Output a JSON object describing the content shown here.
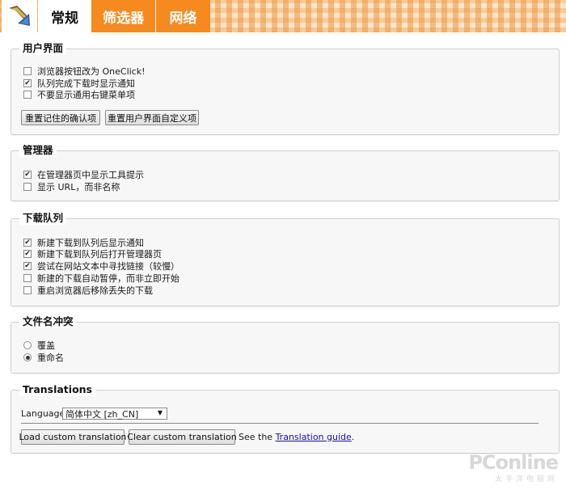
{
  "tabs": [
    {
      "label": "常规",
      "active": true
    },
    {
      "label": "筛选器",
      "active": false
    },
    {
      "label": "网络",
      "active": false
    }
  ],
  "ui_section": {
    "title": "用户界面",
    "options": [
      {
        "label": "浏览器按钮改为 OneClick!",
        "checked": false
      },
      {
        "label": "队列完成下载时显示通知",
        "checked": true
      },
      {
        "label": "不要显示通用右键菜单项",
        "checked": false
      }
    ],
    "reset_confirm_label": "重置记住的确认项",
    "reset_custom_label": "重置用户界面自定义项"
  },
  "manager_section": {
    "title": "管理器",
    "options": [
      {
        "label": "在管理器页中显示工具提示",
        "checked": true
      },
      {
        "label": "显示 URL，而非名称",
        "checked": false
      }
    ]
  },
  "queue_section": {
    "title": "下载队列",
    "options": [
      {
        "label": "新建下载到队列后显示通知",
        "checked": true
      },
      {
        "label": "新建下载到队列后打开管理器页",
        "checked": true
      },
      {
        "label": "尝试在网站文本中寻找链接（较慢）",
        "checked": true
      },
      {
        "label": "新建的下载自动暂停，而非立即开始",
        "checked": false
      },
      {
        "label": "重启浏览器后移除丢失的下载",
        "checked": false
      }
    ]
  },
  "conflict_section": {
    "title": "文件名冲突",
    "options": [
      {
        "label": "覆盖",
        "selected": false
      },
      {
        "label": "重命名",
        "selected": true
      }
    ]
  },
  "translations_section": {
    "title": "Translations",
    "language_label": "Language:",
    "language_value": "简体中文 [zh_CN]",
    "load_label": "Load custom translation",
    "clear_label": "Clear custom translation",
    "see_the": "See the",
    "guide_link": "Translation guide",
    "period": "."
  },
  "watermark": {
    "main": "PConline",
    "sub": "太平洋电脑网"
  },
  "colors": {
    "tab_orange": "#f68a1e",
    "panel_bg": "#f7f7f7",
    "link": "#1a0dab"
  }
}
